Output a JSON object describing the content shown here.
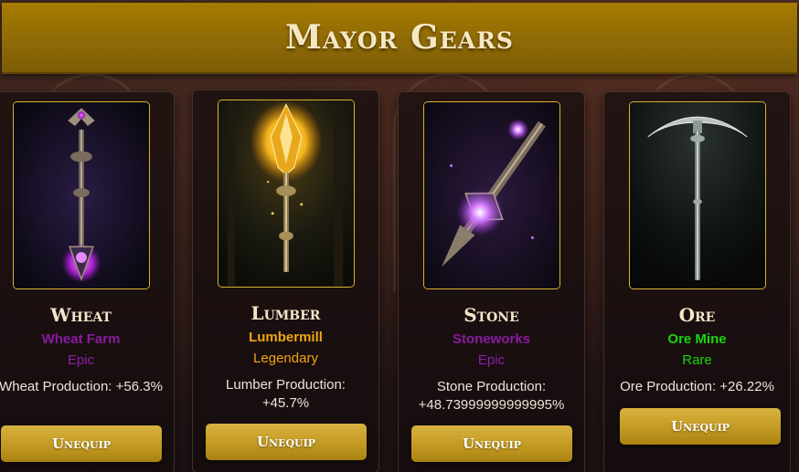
{
  "header": {
    "title": "Mayor Gears"
  },
  "gears": [
    {
      "name": "Wheat",
      "building": "Wheat Farm",
      "rarity": "Epic",
      "production": "Wheat Production: +56.3%",
      "button": "Unequip",
      "rarity_color": "#8e1fa8"
    },
    {
      "name": "Lumber",
      "building": "Lumbermill",
      "rarity": "Legendary",
      "production": "Lumber Production: +45.7%",
      "button": "Unequip",
      "rarity_color": "#f1a511"
    },
    {
      "name": "Stone",
      "building": "Stoneworks",
      "rarity": "Epic",
      "production": "Stone Production: +48.73999999999995%",
      "button": "Unequip",
      "rarity_color": "#8e1fa8"
    },
    {
      "name": "Ore",
      "building": "Ore Mine",
      "rarity": "Rare",
      "production": "Ore Production: +26.22%",
      "button": "Unequip",
      "rarity_color": "#16d80c"
    }
  ],
  "icons": [
    "scepter-wheat-icon",
    "scepter-lumber-icon",
    "sword-stone-icon",
    "pickaxe-ore-icon"
  ],
  "colors": {
    "header_gold": "#a67c00",
    "button_gold": "#c39a22",
    "card_bg": "#1e1214"
  }
}
